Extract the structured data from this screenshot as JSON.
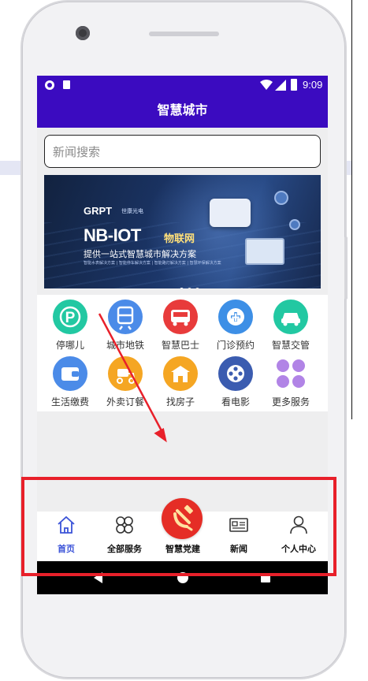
{
  "status_bar": {
    "time": "9:09",
    "icons": [
      "sync-icon",
      "sim-card-icon",
      "wifi-icon",
      "signal-icon",
      "battery-icon"
    ]
  },
  "app": {
    "title": "智慧城市"
  },
  "search": {
    "placeholder": "新闻搜索",
    "value": ""
  },
  "banner": {
    "brand": "GRPT",
    "brand_sub": "世康光电",
    "title": "NB-IOT",
    "title_cn": "物联网",
    "subtitle": "提供一站式智慧城市解决方案",
    "fine_print": "智能水表解决方案 | 智能停车解决方案 | 智能路灯解决方案 | 智慧环保解决方案",
    "page_count": 3,
    "active_page": 1
  },
  "services": [
    {
      "label": "停哪儿",
      "icon": "parking-icon",
      "glyph": "P",
      "color": "#22c8a2"
    },
    {
      "label": "城市地铁",
      "icon": "metro-icon",
      "glyph": "",
      "color": "#4b8be8"
    },
    {
      "label": "智慧巴士",
      "icon": "bus-icon",
      "glyph": "",
      "color": "#e83b3b"
    },
    {
      "label": "门诊预约",
      "icon": "clinic-icon",
      "glyph": "+",
      "color": "#3d8fe6"
    },
    {
      "label": "智慧交管",
      "icon": "traffic-car-icon",
      "glyph": "",
      "color": "#22c8a2"
    },
    {
      "label": "生活缴费",
      "icon": "wallet-icon",
      "glyph": "",
      "color": "#4b8be8"
    },
    {
      "label": "外卖订餐",
      "icon": "delivery-icon",
      "glyph": "",
      "color": "#f5a623"
    },
    {
      "label": "找房子",
      "icon": "house-icon",
      "glyph": "",
      "color": "#f5a623"
    },
    {
      "label": "看电影",
      "icon": "film-reel-icon",
      "glyph": "",
      "color": "#3b5cb0"
    },
    {
      "label": "更多服务",
      "icon": "more-dots-icon",
      "glyph": "",
      "color": "#b184e6"
    }
  ],
  "bottom_nav": {
    "home": "首页",
    "all_services": "全部服务",
    "party": "智慧党建",
    "news": "新闻",
    "profile": "个人中心",
    "active": "home",
    "active_color": "#3b53d8",
    "party_color": "#e52d26"
  },
  "annotation": {
    "highlight_color": "#e8202a"
  }
}
